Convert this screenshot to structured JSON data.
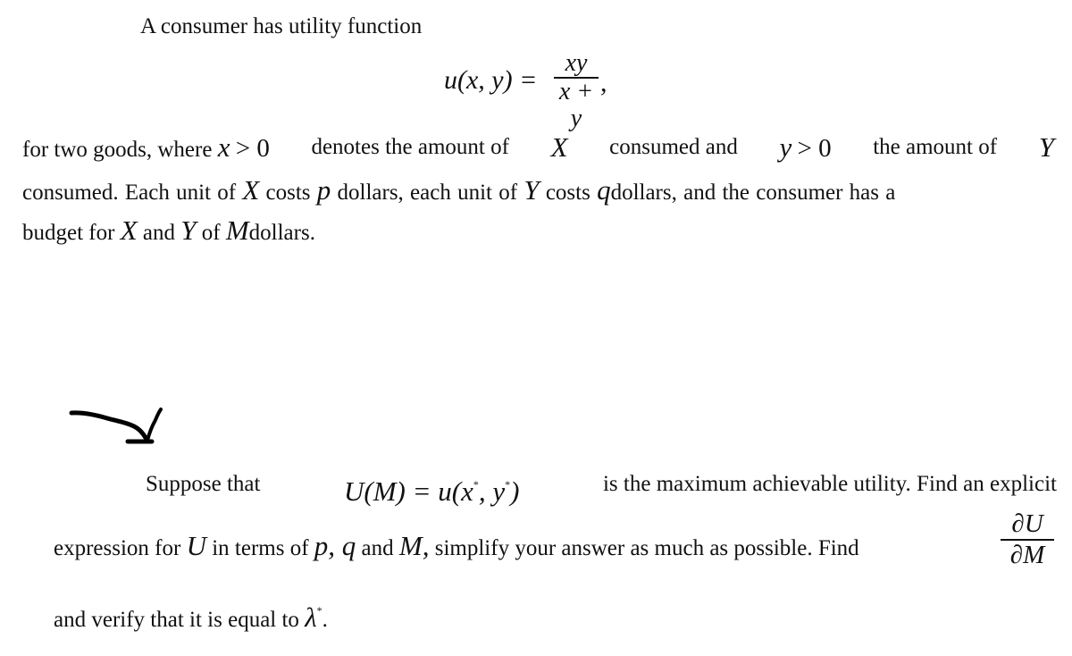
{
  "paragraph1": {
    "intro": "A consumer has utility function",
    "formula": {
      "lhs": "u(x, y) =",
      "numerator": "xy",
      "denominator": "x + y",
      "trail": ","
    },
    "line1": {
      "t1": "for two goods, where",
      "m1": "x",
      "m1b": "> 0",
      "t2": "denotes the amount of",
      "m2": "X",
      "t3": "consumed and",
      "m3": "y",
      "m3b": "> 0",
      "t4": "the amount of",
      "m4": "Y"
    },
    "line2": {
      "t1": "consumed. Each unit of",
      "m1": "X",
      "t2": "costs",
      "m2": "p",
      "t3": "dollars, each unit of",
      "m3": "Y",
      "t4": "costs",
      "m4": "q",
      "t5": "dollars, and the consumer has a"
    },
    "line3": {
      "t1": "budget for",
      "m1": "X",
      "t2": "and",
      "m2": "Y",
      "t3": "of",
      "m3": "M",
      "t4": "dollars."
    }
  },
  "annotation": {
    "icon": "hand-drawn-arrow-icon"
  },
  "paragraph2": {
    "line1": {
      "t1": "Suppose that",
      "m1": "U(M) = u(x",
      "star": "*",
      "m2": ", y",
      "m3": ")",
      "t2": "is the maximum achievable utility. Find an explicit"
    },
    "line2": {
      "t1": "expression for",
      "m1": "U",
      "t2": "in terms of",
      "m2": "p, q",
      "t3": "and",
      "m3": "M,",
      "t4": "simplify your answer as much as possible. Find",
      "frac_num": "∂U",
      "frac_den": "∂M"
    },
    "line3": {
      "t1": "and verify that it is equal to",
      "m1": "λ",
      "star": "*",
      "t2": "."
    }
  }
}
